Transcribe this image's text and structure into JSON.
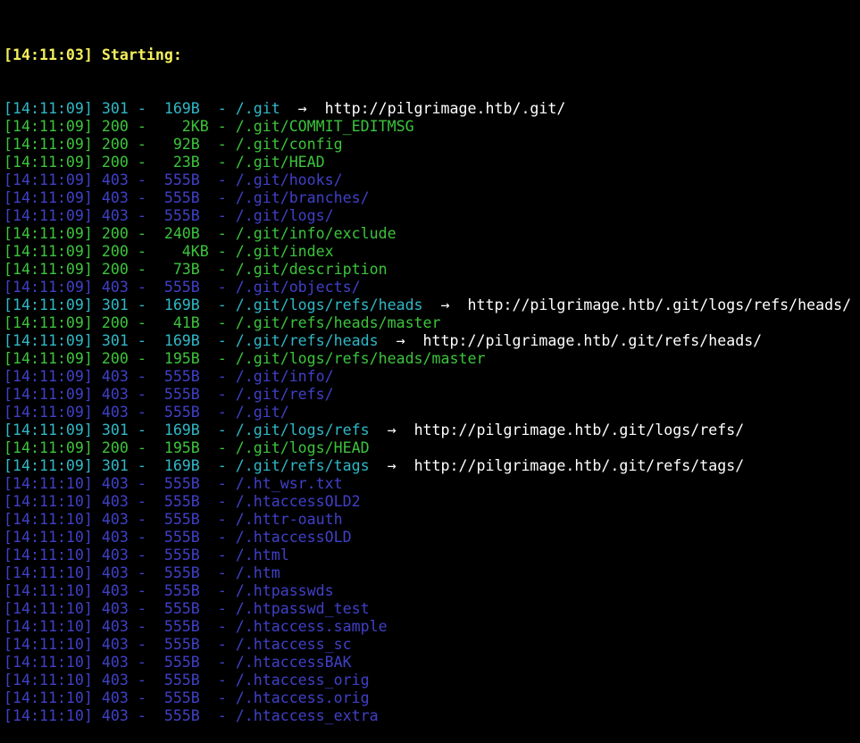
{
  "colors": {
    "background": "#000000",
    "header": "#f5f05c",
    "status_301": "#2fb8c6",
    "status_200": "#3cc43c",
    "status_403": "#4040c8",
    "redirect_target": "#ffffff"
  },
  "header": "[14:11:03] Starting:",
  "lines": [
    {
      "status_class": "s301",
      "text": "[14:11:09] 301 -  169B  - /.git",
      "arrow": "  ->  ",
      "redirect": "http://pilgrimage.htb/.git/"
    },
    {
      "status_class": "s200",
      "text": "[14:11:09] 200 -    2KB - /.git/COMMIT_EDITMSG",
      "arrow": "",
      "redirect": ""
    },
    {
      "status_class": "s200",
      "text": "[14:11:09] 200 -   92B  - /.git/config",
      "arrow": "",
      "redirect": ""
    },
    {
      "status_class": "s200",
      "text": "[14:11:09] 200 -   23B  - /.git/HEAD",
      "arrow": "",
      "redirect": ""
    },
    {
      "status_class": "s403",
      "text": "[14:11:09] 403 -  555B  - /.git/hooks/",
      "arrow": "",
      "redirect": ""
    },
    {
      "status_class": "s403",
      "text": "[14:11:09] 403 -  555B  - /.git/branches/",
      "arrow": "",
      "redirect": ""
    },
    {
      "status_class": "s403",
      "text": "[14:11:09] 403 -  555B  - /.git/logs/",
      "arrow": "",
      "redirect": ""
    },
    {
      "status_class": "s200",
      "text": "[14:11:09] 200 -  240B  - /.git/info/exclude",
      "arrow": "",
      "redirect": ""
    },
    {
      "status_class": "s200",
      "text": "[14:11:09] 200 -    4KB - /.git/index",
      "arrow": "",
      "redirect": ""
    },
    {
      "status_class": "s200",
      "text": "[14:11:09] 200 -   73B  - /.git/description",
      "arrow": "",
      "redirect": ""
    },
    {
      "status_class": "s403",
      "text": "[14:11:09] 403 -  555B  - /.git/objects/",
      "arrow": "",
      "redirect": ""
    },
    {
      "status_class": "s301",
      "text": "[14:11:09] 301 -  169B  - /.git/logs/refs/heads",
      "arrow": "  ->  ",
      "redirect": "http://pilgrimage.htb/.git/logs/refs/heads/"
    },
    {
      "status_class": "s200",
      "text": "[14:11:09] 200 -   41B  - /.git/refs/heads/master",
      "arrow": "",
      "redirect": ""
    },
    {
      "status_class": "s301",
      "text": "[14:11:09] 301 -  169B  - /.git/refs/heads",
      "arrow": "  ->  ",
      "redirect": "http://pilgrimage.htb/.git/refs/heads/"
    },
    {
      "status_class": "s200",
      "text": "[14:11:09] 200 -  195B  - /.git/logs/refs/heads/master",
      "arrow": "",
      "redirect": ""
    },
    {
      "status_class": "s403",
      "text": "[14:11:09] 403 -  555B  - /.git/info/",
      "arrow": "",
      "redirect": ""
    },
    {
      "status_class": "s403",
      "text": "[14:11:09] 403 -  555B  - /.git/refs/",
      "arrow": "",
      "redirect": ""
    },
    {
      "status_class": "s403",
      "text": "[14:11:09] 403 -  555B  - /.git/",
      "arrow": "",
      "redirect": ""
    },
    {
      "status_class": "s301",
      "text": "[14:11:09] 301 -  169B  - /.git/logs/refs",
      "arrow": "  ->  ",
      "redirect": "http://pilgrimage.htb/.git/logs/refs/"
    },
    {
      "status_class": "s200",
      "text": "[14:11:09] 200 -  195B  - /.git/logs/HEAD",
      "arrow": "",
      "redirect": ""
    },
    {
      "status_class": "s301",
      "text": "[14:11:09] 301 -  169B  - /.git/refs/tags",
      "arrow": "  ->  ",
      "redirect": "http://pilgrimage.htb/.git/refs/tags/"
    },
    {
      "status_class": "s403",
      "text": "[14:11:10] 403 -  555B  - /.ht_wsr.txt",
      "arrow": "",
      "redirect": ""
    },
    {
      "status_class": "s403",
      "text": "[14:11:10] 403 -  555B  - /.htaccessOLD2",
      "arrow": "",
      "redirect": ""
    },
    {
      "status_class": "s403",
      "text": "[14:11:10] 403 -  555B  - /.httr-oauth",
      "arrow": "",
      "redirect": ""
    },
    {
      "status_class": "s403",
      "text": "[14:11:10] 403 -  555B  - /.htaccessOLD",
      "arrow": "",
      "redirect": ""
    },
    {
      "status_class": "s403",
      "text": "[14:11:10] 403 -  555B  - /.html",
      "arrow": "",
      "redirect": ""
    },
    {
      "status_class": "s403",
      "text": "[14:11:10] 403 -  555B  - /.htm",
      "arrow": "",
      "redirect": ""
    },
    {
      "status_class": "s403",
      "text": "[14:11:10] 403 -  555B  - /.htpasswds",
      "arrow": "",
      "redirect": ""
    },
    {
      "status_class": "s403",
      "text": "[14:11:10] 403 -  555B  - /.htpasswd_test",
      "arrow": "",
      "redirect": ""
    },
    {
      "status_class": "s403",
      "text": "[14:11:10] 403 -  555B  - /.htaccess.sample",
      "arrow": "",
      "redirect": ""
    },
    {
      "status_class": "s403",
      "text": "[14:11:10] 403 -  555B  - /.htaccess_sc",
      "arrow": "",
      "redirect": ""
    },
    {
      "status_class": "s403",
      "text": "[14:11:10] 403 -  555B  - /.htaccessBAK",
      "arrow": "",
      "redirect": ""
    },
    {
      "status_class": "s403",
      "text": "[14:11:10] 403 -  555B  - /.htaccess_orig",
      "arrow": "",
      "redirect": ""
    },
    {
      "status_class": "s403",
      "text": "[14:11:10] 403 -  555B  - /.htaccess.orig",
      "arrow": "",
      "redirect": ""
    },
    {
      "status_class": "s403",
      "text": "[14:11:10] 403 -  555B  - /.htaccess_extra",
      "arrow": "",
      "redirect": ""
    }
  ]
}
